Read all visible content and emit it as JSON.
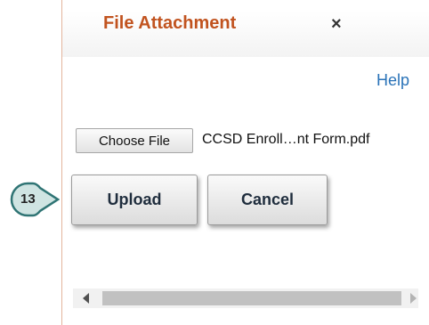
{
  "dialog": {
    "title": "File Attachment",
    "close_label": "×",
    "help_label": "Help"
  },
  "file_input": {
    "button_label": "Choose File",
    "file_name": "CCSD Enroll…nt Form.pdf"
  },
  "actions": {
    "upload_label": "Upload",
    "cancel_label": "Cancel"
  },
  "callout": {
    "number": "13",
    "fill_color": "#cfe4e2",
    "border_color": "#2f7474"
  },
  "colors": {
    "title": "#c1531f",
    "link": "#2a73b8"
  }
}
